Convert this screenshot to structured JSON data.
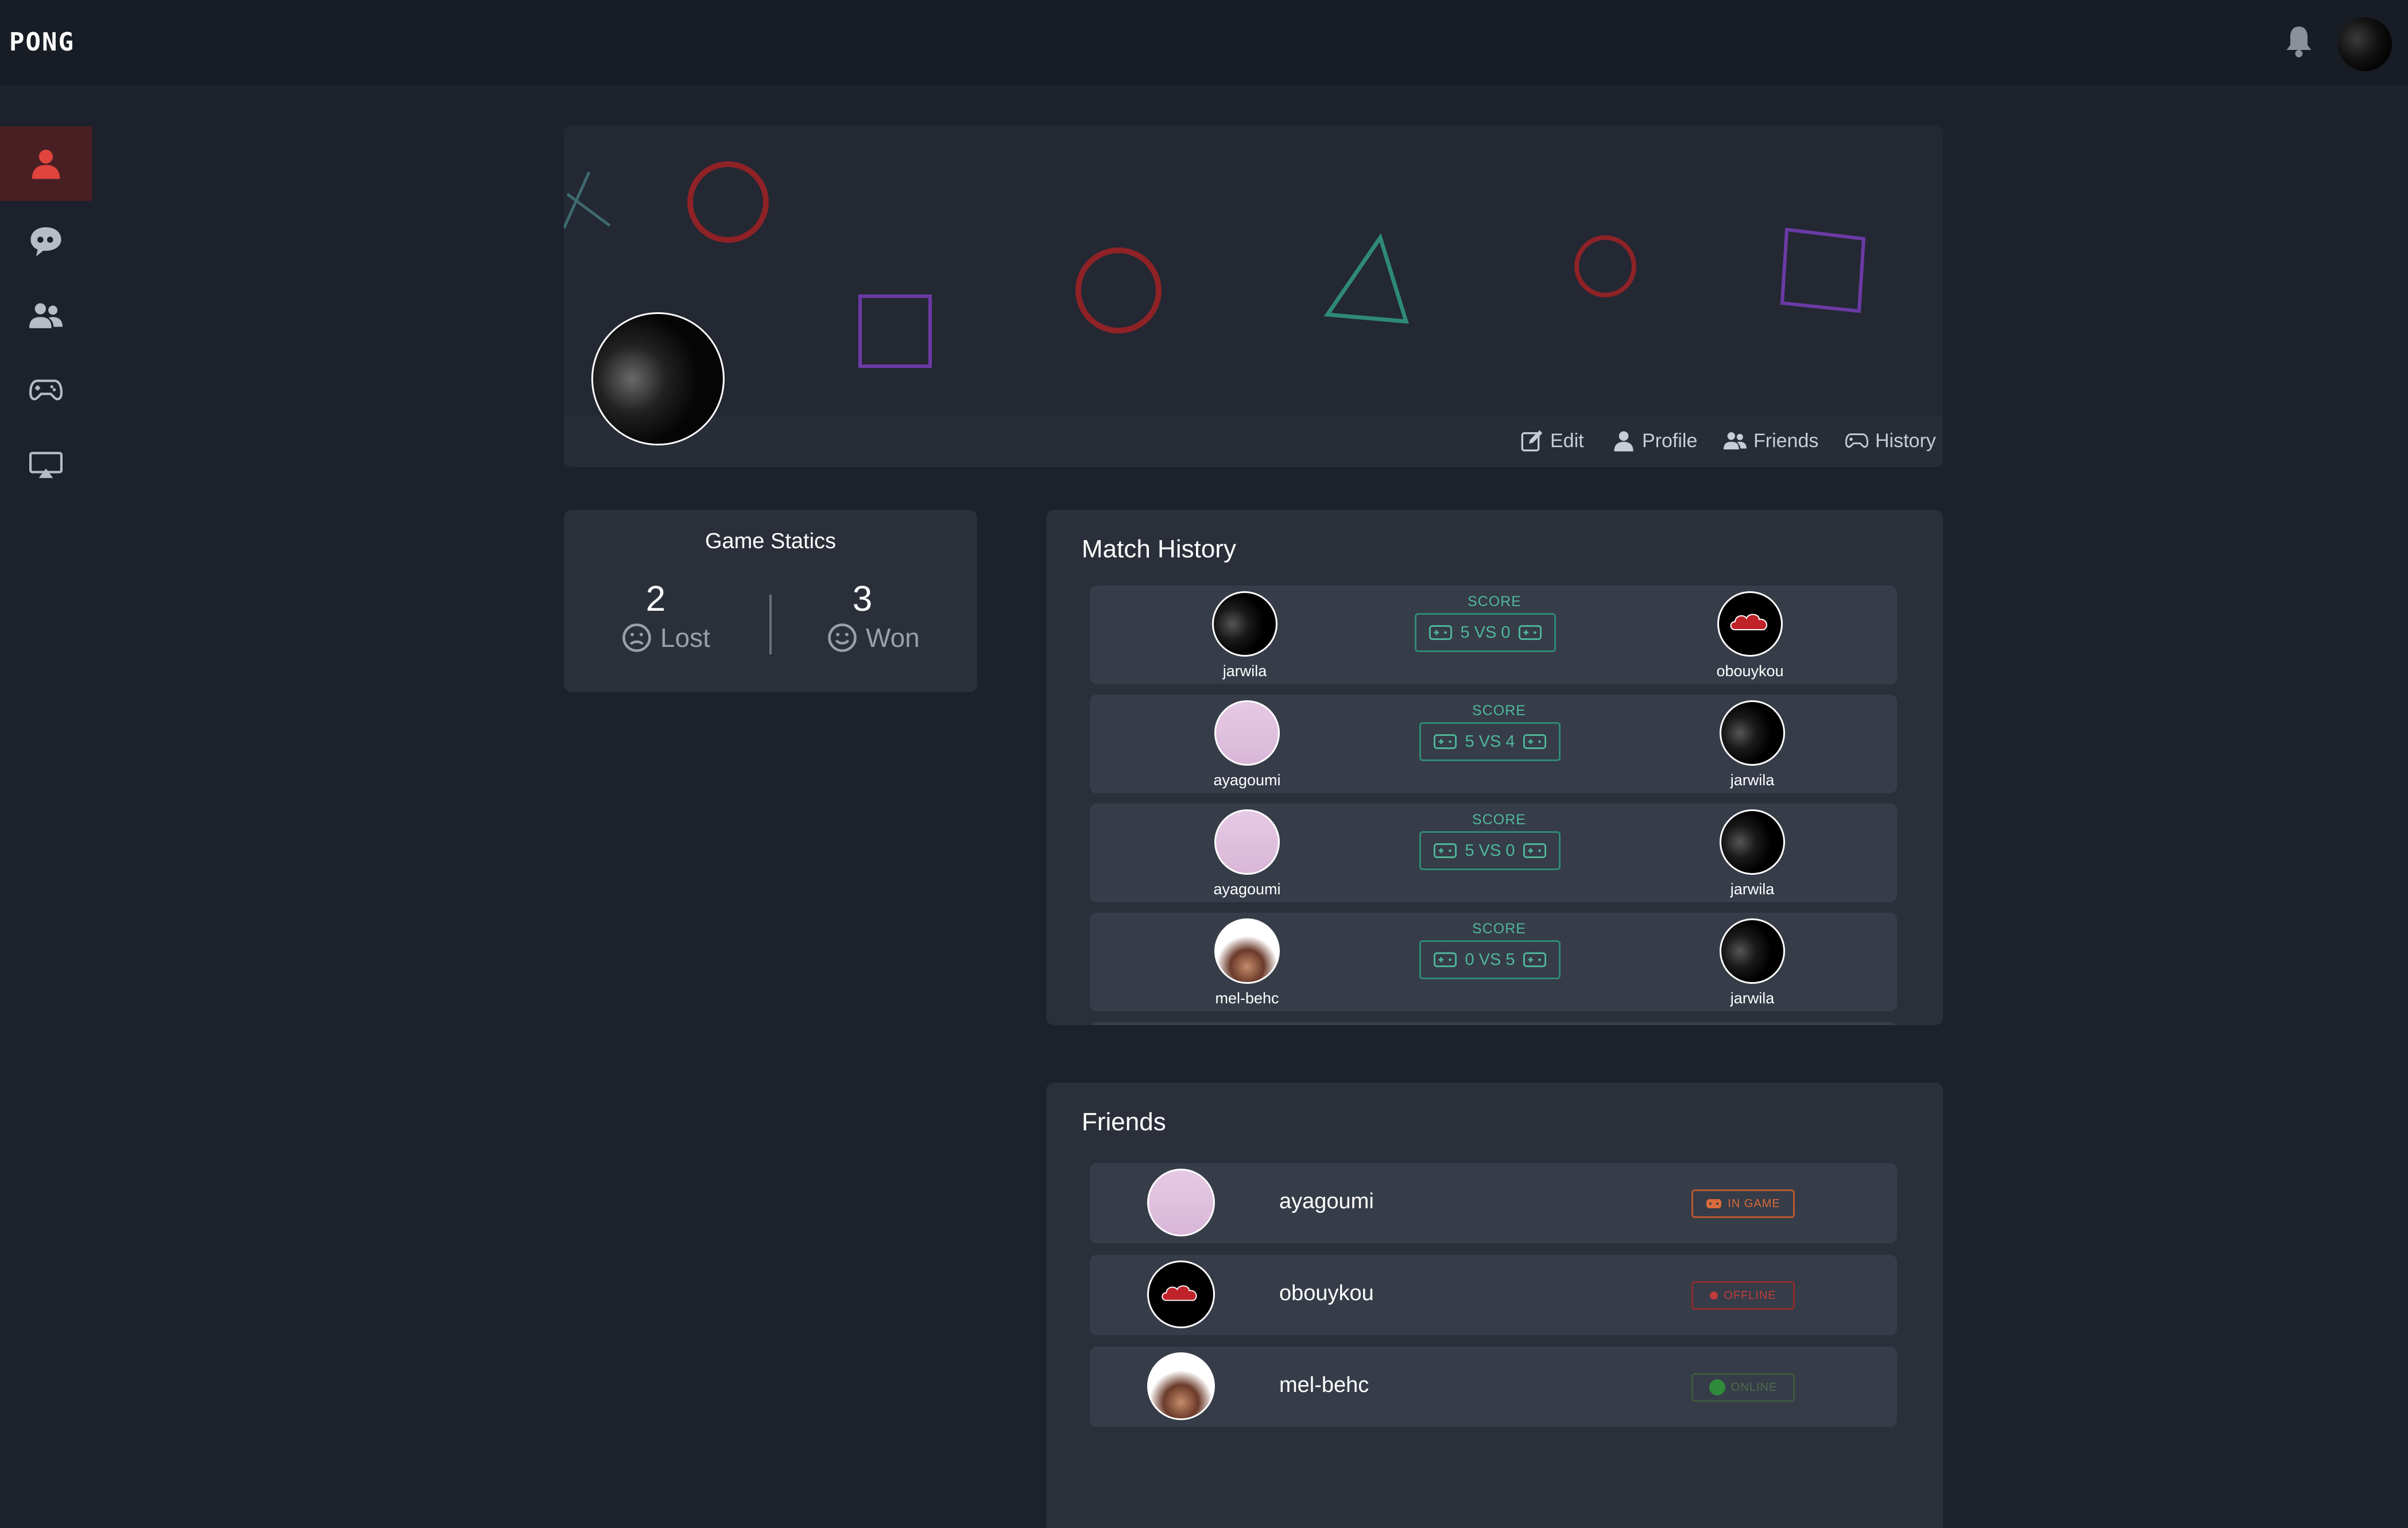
{
  "app": {
    "logo_text": "PONG"
  },
  "topbar": {
    "notification_icon": "bell-icon",
    "avatar_icon": "user-avatar"
  },
  "sidebar": {
    "items": [
      {
        "icon": "user-icon",
        "active": true
      },
      {
        "icon": "chat-icon",
        "active": false
      },
      {
        "icon": "friends-icon",
        "active": false
      },
      {
        "icon": "gamepad-icon",
        "active": false
      },
      {
        "icon": "screen-icon",
        "active": false
      }
    ]
  },
  "banner": {
    "nav": [
      {
        "label": "Edit",
        "icon": "edit-icon"
      },
      {
        "label": "Profile",
        "icon": "user-icon"
      },
      {
        "label": "Friends",
        "icon": "friends-icon"
      },
      {
        "label": "History",
        "icon": "gamepad-icon"
      }
    ]
  },
  "stats": {
    "title": "Game Statics",
    "lost": {
      "value": "2",
      "label": "Lost"
    },
    "won": {
      "value": "3",
      "label": "Won"
    }
  },
  "match_history": {
    "title": "Match History",
    "score_label": "SCORE",
    "matches": [
      {
        "left": "jarwila",
        "right": "obouykou",
        "score": "5 VS 0"
      },
      {
        "left": "ayagoumi",
        "right": "jarwila",
        "score": "5 VS 4"
      },
      {
        "left": "ayagoumi",
        "right": "jarwila",
        "score": "5 VS 0"
      },
      {
        "left": "mel-behc",
        "right": "jarwila",
        "score": "0 VS 5"
      }
    ]
  },
  "friends": {
    "title": "Friends",
    "list": [
      {
        "name": "ayagoumi",
        "status": "IN GAME"
      },
      {
        "name": "obouykou",
        "status": "OFFLINE"
      },
      {
        "name": "mel-behc",
        "status": "ONLINE"
      }
    ]
  },
  "colors": {
    "accent_red": "#e0443c",
    "score_green": "#4fb89a",
    "background": "#1c212b"
  }
}
